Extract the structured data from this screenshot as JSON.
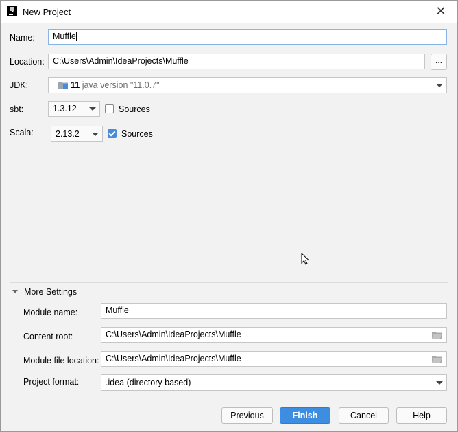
{
  "window": {
    "title": "New Project",
    "close_label": "✕"
  },
  "form": {
    "name_label": "Name:",
    "name_value": "Muffle",
    "location_label": "Location:",
    "location_value": "C:\\Users\\Admin\\IdeaProjects\\Muffle",
    "browse_label": "...",
    "jdk_label": "JDK:",
    "jdk_version": "11",
    "jdk_description": "java version \"11.0.7\"",
    "sbt_label": "sbt:",
    "sbt_version": "1.3.12",
    "sbt_sources_label": "Sources",
    "sbt_sources_checked": false,
    "scala_label": "Scala:",
    "scala_version": "2.13.2",
    "scala_sources_label": "Sources",
    "scala_sources_checked": true
  },
  "more_settings": {
    "header": "More Settings",
    "expanded": true,
    "module_name_label": "Module name:",
    "module_name_value": "Muffle",
    "content_root_label": "Content root:",
    "content_root_value": "C:\\Users\\Admin\\IdeaProjects\\Muffle",
    "module_file_label": "Module file location:",
    "module_file_value": "C:\\Users\\Admin\\IdeaProjects\\Muffle",
    "project_format_label": "Project format:",
    "project_format_value": ".idea (directory based)"
  },
  "buttons": {
    "previous": "Previous",
    "finish": "Finish",
    "cancel": "Cancel",
    "help": "Help"
  },
  "colors": {
    "accent": "#3d8ee0",
    "dialog_bg": "#f2f2f2",
    "focus_border": "#8ab4e6"
  },
  "icons": {
    "app": "intellij-icon",
    "jdk": "folder-jdk-icon",
    "browse_folder": "folder-icon",
    "close": "close-icon"
  }
}
